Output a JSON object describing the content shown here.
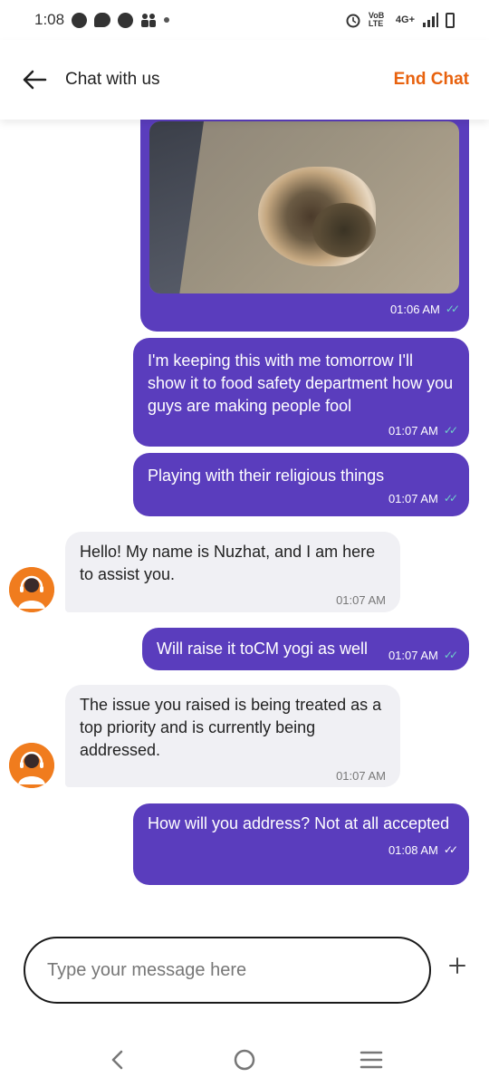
{
  "status_bar": {
    "time": "1:08",
    "network": "4G+",
    "volte_label": "VoB LTE"
  },
  "header": {
    "title": "Chat with us",
    "end_chat_label": "End Chat",
    "accent_color": "#e8620e"
  },
  "messages": [
    {
      "direction": "out",
      "type": "image",
      "time": "01:06 AM",
      "status": "delivered"
    },
    {
      "direction": "out",
      "text": "I'm keeping this with me tomorrow I'll show it to food safety department how you guys are making people fool",
      "time": "01:07 AM",
      "status": "delivered"
    },
    {
      "direction": "out",
      "text": "Playing with their religious things",
      "time": "01:07 AM",
      "status": "delivered"
    },
    {
      "direction": "in",
      "text": "Hello! My name is Nuzhat, and I am here to assist you.",
      "time": "01:07 AM"
    },
    {
      "direction": "out",
      "text": "Will raise it toCM yogi as well",
      "time": "01:07 AM",
      "status": "delivered"
    },
    {
      "direction": "in",
      "text": "The issue you raised is being treated as a top priority and is currently being addressed.",
      "time": "01:07 AM"
    },
    {
      "direction": "out",
      "text": "How will you address? Not at all accepted",
      "time": "01:08 AM",
      "status": "sent"
    }
  ],
  "composer": {
    "placeholder": "Type your message here",
    "value": ""
  },
  "colors": {
    "outgoing_bubble": "#5a3dbd",
    "incoming_bubble": "#f0f0f4",
    "avatar": "#f07c1e",
    "read_tick": "#6fd1c8"
  },
  "icons": {
    "back": "arrow-left-icon",
    "add": "plus-icon",
    "nav_back": "chevron-left-icon",
    "nav_home": "circle-home-icon",
    "nav_recent": "menu-lines-icon"
  }
}
